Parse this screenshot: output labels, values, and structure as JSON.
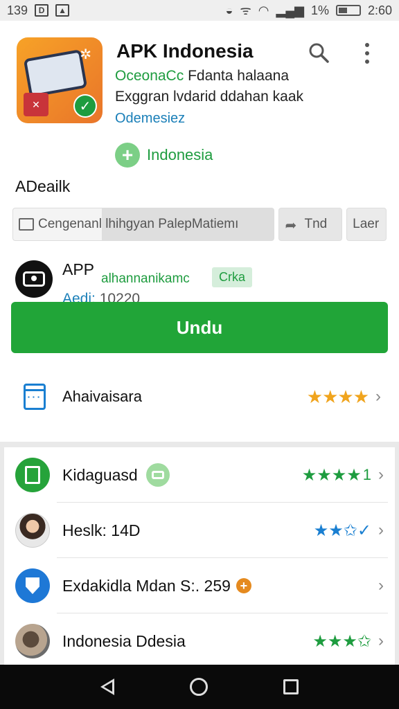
{
  "status_bar": {
    "time_left": "139",
    "time_right": "2:60",
    "battery_text": "1%"
  },
  "app": {
    "title": "APK Indonesia",
    "developer": "OceonaCc",
    "developer_suffix": "Fdanta halaana",
    "description": "Exggran lvdarid ddahan kaak",
    "category": "Odemesiez",
    "region": "Indonesia"
  },
  "section": {
    "title": "ADeailk"
  },
  "chips": {
    "chip1": "Cengenanl lhihgyan PalepMatiemı",
    "chip2": "Tnd",
    "chip3": "Laer"
  },
  "info": {
    "label": "APP",
    "tagline": "alhannanikamc",
    "badge": "Crka",
    "sub_key": "Aedi:",
    "sub_value": "10220"
  },
  "download_button": "Undu",
  "feature": {
    "label": "Ahaivaisara",
    "rating": "★★★★"
  },
  "list": [
    {
      "label": "Kidaguasd",
      "stars": "★★★★",
      "rating": "1"
    },
    {
      "label": "Heslk: 14D",
      "stars": "★★✩✓"
    },
    {
      "label": "Exdakidla Mdan S:. 259"
    },
    {
      "label": "Indonesia Ddesia",
      "stars": "★★★✩"
    }
  ],
  "colors": {
    "accent_green": "#21a538",
    "star_orange": "#f0a41d",
    "link_blue": "#1a7fb8"
  }
}
